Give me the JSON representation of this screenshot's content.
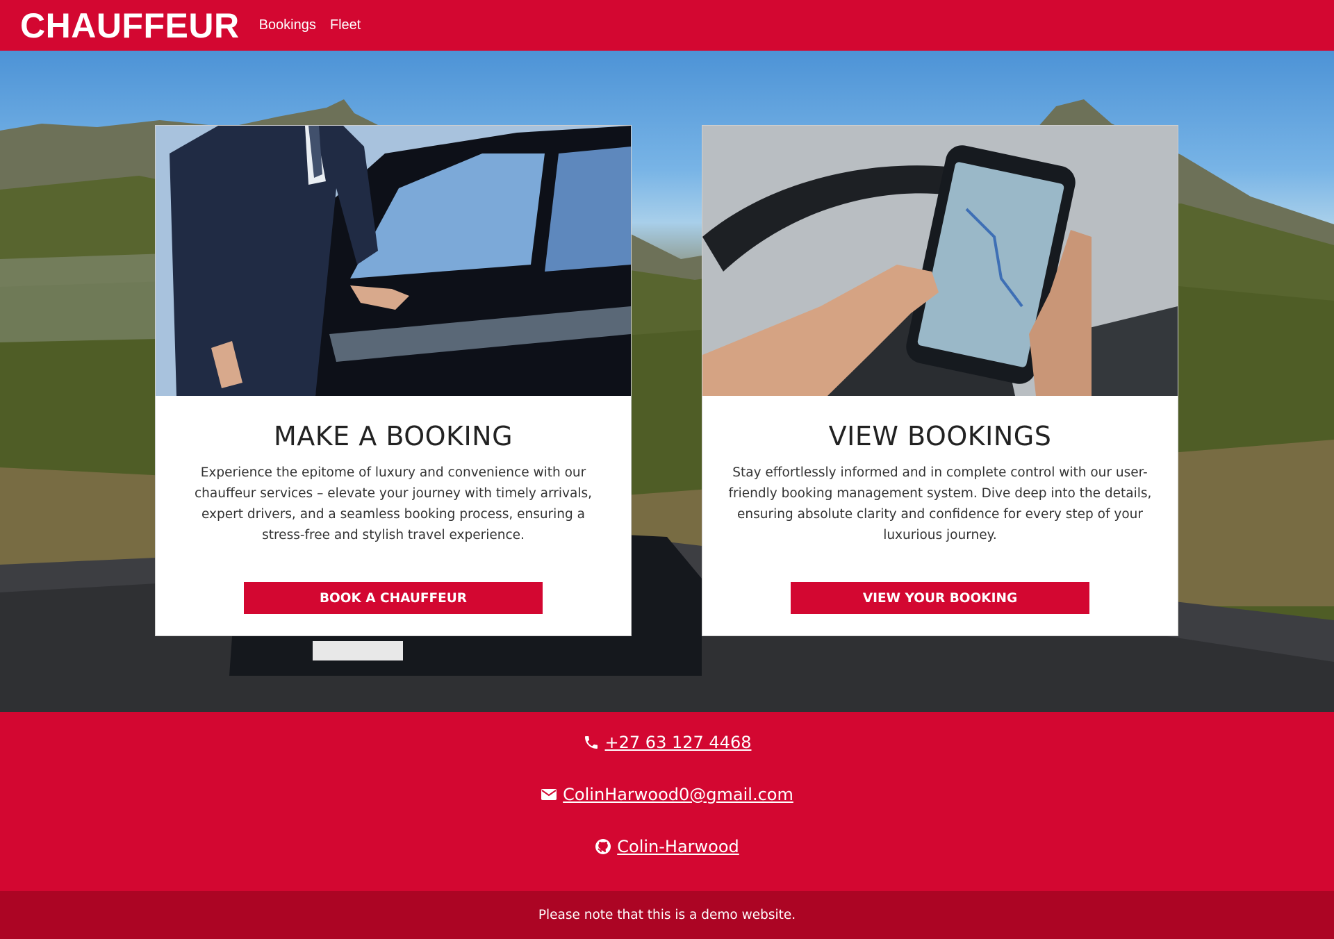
{
  "navbar": {
    "brand": "CHAUFFEUR",
    "links": [
      {
        "label": "Bookings"
      },
      {
        "label": "Fleet"
      }
    ]
  },
  "cards": [
    {
      "title": "MAKE A BOOKING",
      "text": "Experience the epitome of luxury and convenience with our chauffeur services – elevate your journey with timely arrivals, expert drivers, and a seamless booking process, ensuring a stress-free and stylish travel experience.",
      "button": "BOOK A CHAUFFEUR",
      "image_icon": "chauffeur-opening-car-door-photo"
    },
    {
      "title": "VIEW BOOKINGS",
      "text": "Stay effortlessly informed and in complete control with our user-friendly booking management system. Dive deep into the details, ensuring absolute clarity and confidence for every step of your luxurious journey.",
      "button": "VIEW YOUR BOOKING",
      "image_icon": "phone-map-in-car-photo"
    }
  ],
  "contact": {
    "phone": " +27 63 127 4468",
    "email": " ColinHarwood0@gmail.com",
    "github": " Colin-Harwood"
  },
  "footer": {
    "note": "Please note that this is a demo website."
  },
  "colors": {
    "brand_red": "#d30731",
    "footer_red": "#ac0524",
    "card_bg": "#ffffff"
  }
}
